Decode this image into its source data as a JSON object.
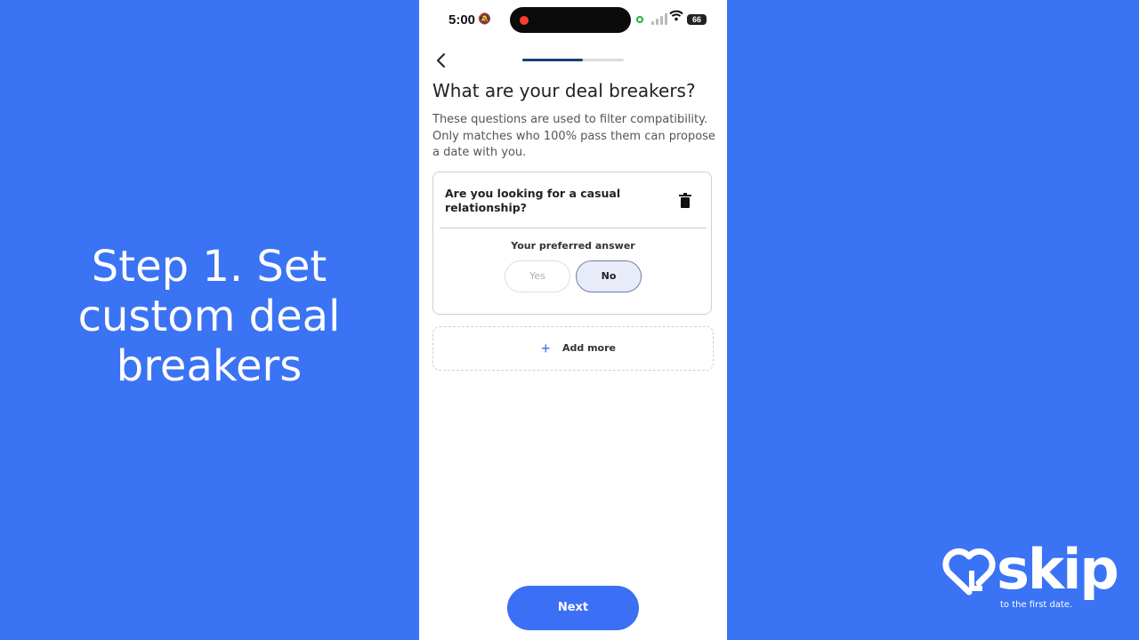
{
  "caption": {
    "lines": [
      "Step 1. Set",
      "custom deal",
      "breakers"
    ]
  },
  "status_bar": {
    "time": "5:00",
    "battery": "66",
    "icons": [
      "bell-slash-icon",
      "recording-dot-icon",
      "camera-in-use-icon",
      "signal-icon",
      "wifi-icon",
      "battery-icon"
    ]
  },
  "header": {
    "back_icon": "chevron-left-icon",
    "progress": 0.6
  },
  "main": {
    "title": "What are your deal breakers?",
    "description": "These questions are used to filter compatibility. Only matches who 100% pass them can propose a date with you."
  },
  "card": {
    "question": "Are you looking for a casual relationship?",
    "delete_icon": "trash-icon",
    "preferred_label": "Your preferred answer",
    "options": [
      "Yes",
      "No"
    ],
    "selected": "No"
  },
  "add_more": {
    "label": "Add more",
    "icon": "plus-icon"
  },
  "footer": {
    "next_label": "Next"
  },
  "logo": {
    "text": "skip",
    "tagline": "to the first date."
  },
  "colors": {
    "background": "#3b73f5",
    "accent": "#3b6ff5",
    "progress": "#1c3f73"
  }
}
